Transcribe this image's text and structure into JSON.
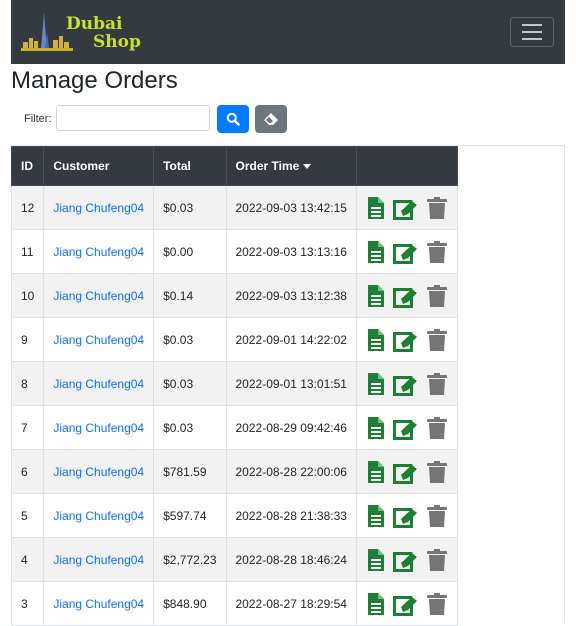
{
  "brand": {
    "line1": "Dubai",
    "line2": "Shop"
  },
  "page": {
    "title": "Manage Orders"
  },
  "filter": {
    "label": "Filter:",
    "value": "",
    "placeholder": ""
  },
  "table": {
    "headers": {
      "id": "ID",
      "customer": "Customer",
      "total": "Total",
      "order_time": "Order Time"
    },
    "rows": [
      {
        "id": "12",
        "customer": "Jiang Chufeng04",
        "total": "$0.03",
        "time": "2022-09-03 13:42:15"
      },
      {
        "id": "11",
        "customer": "Jiang Chufeng04",
        "total": "$0.00",
        "time": "2022-09-03 13:13:16"
      },
      {
        "id": "10",
        "customer": "Jiang Chufeng04",
        "total": "$0.14",
        "time": "2022-09-03 13:12:38"
      },
      {
        "id": "9",
        "customer": "Jiang Chufeng04",
        "total": "$0.03",
        "time": "2022-09-01 14:22:02"
      },
      {
        "id": "8",
        "customer": "Jiang Chufeng04",
        "total": "$0.03",
        "time": "2022-09-01 13:01:51"
      },
      {
        "id": "7",
        "customer": "Jiang Chufeng04",
        "total": "$0.03",
        "time": "2022-08-29 09:42:46"
      },
      {
        "id": "6",
        "customer": "Jiang Chufeng04",
        "total": "$781.59",
        "time": "2022-08-28 22:00:06"
      },
      {
        "id": "5",
        "customer": "Jiang Chufeng04",
        "total": "$597.74",
        "time": "2022-08-28 21:38:33"
      },
      {
        "id": "4",
        "customer": "Jiang Chufeng04",
        "total": "$2,772.23",
        "time": "2022-08-28 18:46:24"
      },
      {
        "id": "3",
        "customer": "Jiang Chufeng04",
        "total": "$848.90",
        "time": "2022-08-27 18:29:54"
      }
    ]
  },
  "icons": {
    "menu": "hamburger-icon",
    "search": "search-icon",
    "clear": "eraser-icon",
    "sort": "caret-down-icon",
    "view": "file-document-icon",
    "edit": "edit-icon",
    "delete": "trash-icon"
  },
  "colors": {
    "navbar": "#343a40",
    "brand_text": "#c7e02b",
    "primary": "#007bff",
    "secondary": "#6c757d",
    "action_green": "#1e7e34",
    "delete_gray": "#757575",
    "link": "#0d6efd"
  }
}
